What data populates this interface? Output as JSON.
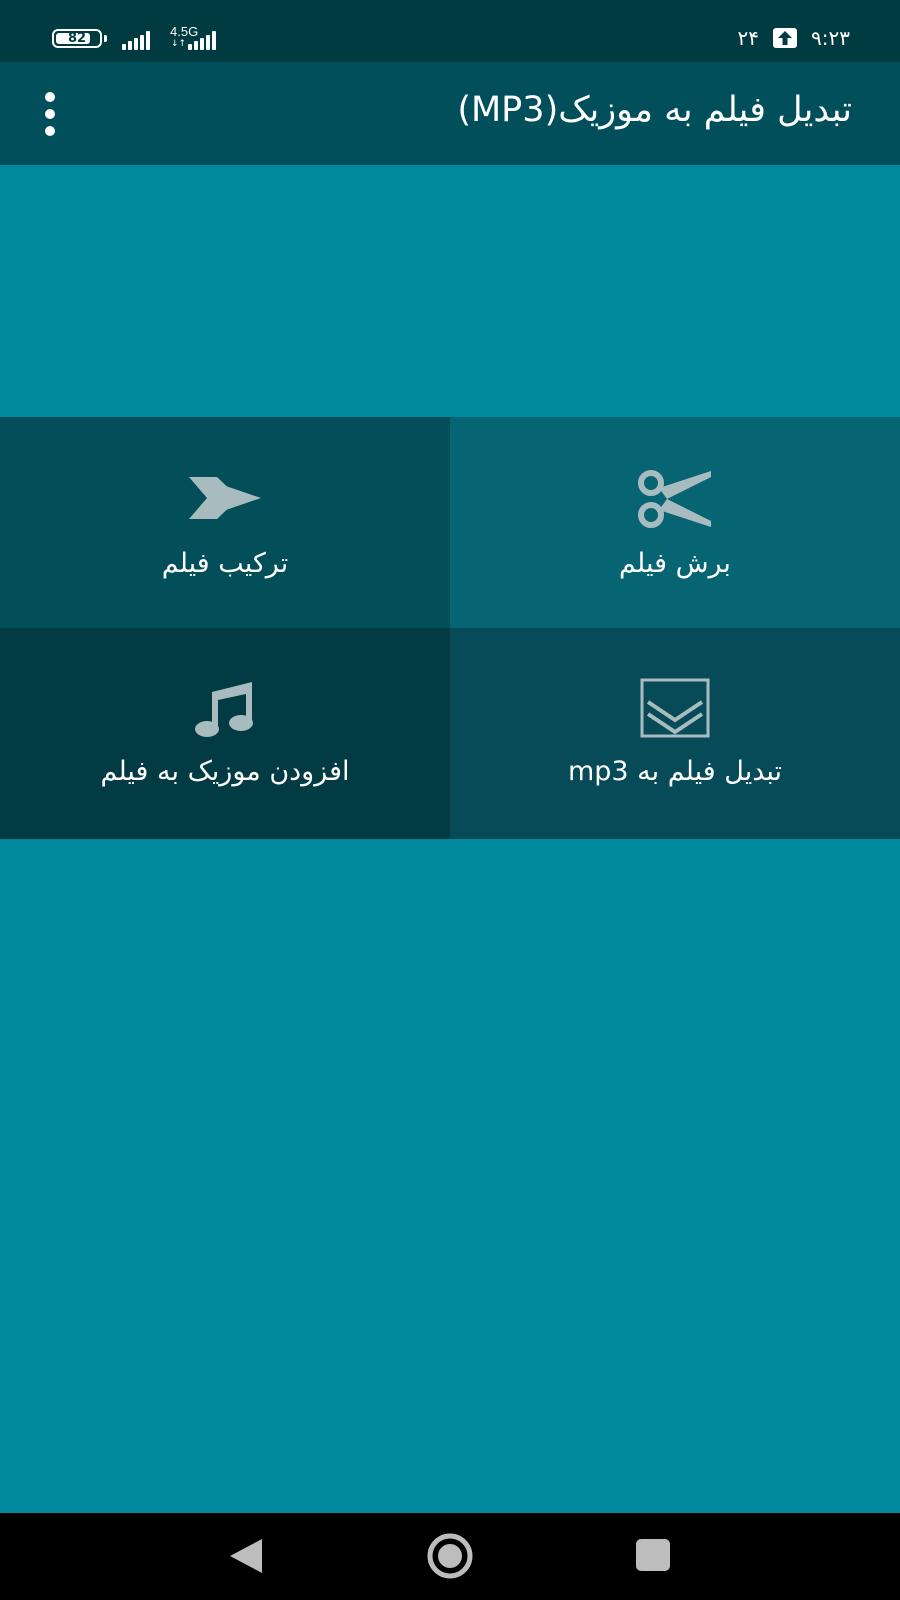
{
  "status_bar": {
    "battery": "82",
    "battery_level": 0.82,
    "network": "4.5G",
    "network_arrows": "↓↑",
    "notification_count": "۲۴",
    "time": "۹:۲۳"
  },
  "app_bar": {
    "title": "تبدیل فیلم به موزیک(MP3)"
  },
  "tiles": [
    {
      "label": "برش فیلم",
      "icon": "scissors-icon",
      "color": "#076573"
    },
    {
      "label": "ترکیب فیلم",
      "icon": "fast-forward-icon",
      "color": "#024f5a"
    },
    {
      "label": "تبدیل فیلم به mp3",
      "icon": "convert-down-icon",
      "color": "#064b57"
    },
    {
      "label": "افزودن موزیک به فیلم",
      "icon": "music-note-icon",
      "color": "#023b43"
    }
  ],
  "colors": {
    "status_bar": "#003b42",
    "app_bar": "#014f5b",
    "background": "#00889e",
    "icon": "#a8bcc0"
  },
  "nav_bar": {
    "back": "back-icon",
    "home": "home-icon",
    "recents": "recents-icon"
  }
}
